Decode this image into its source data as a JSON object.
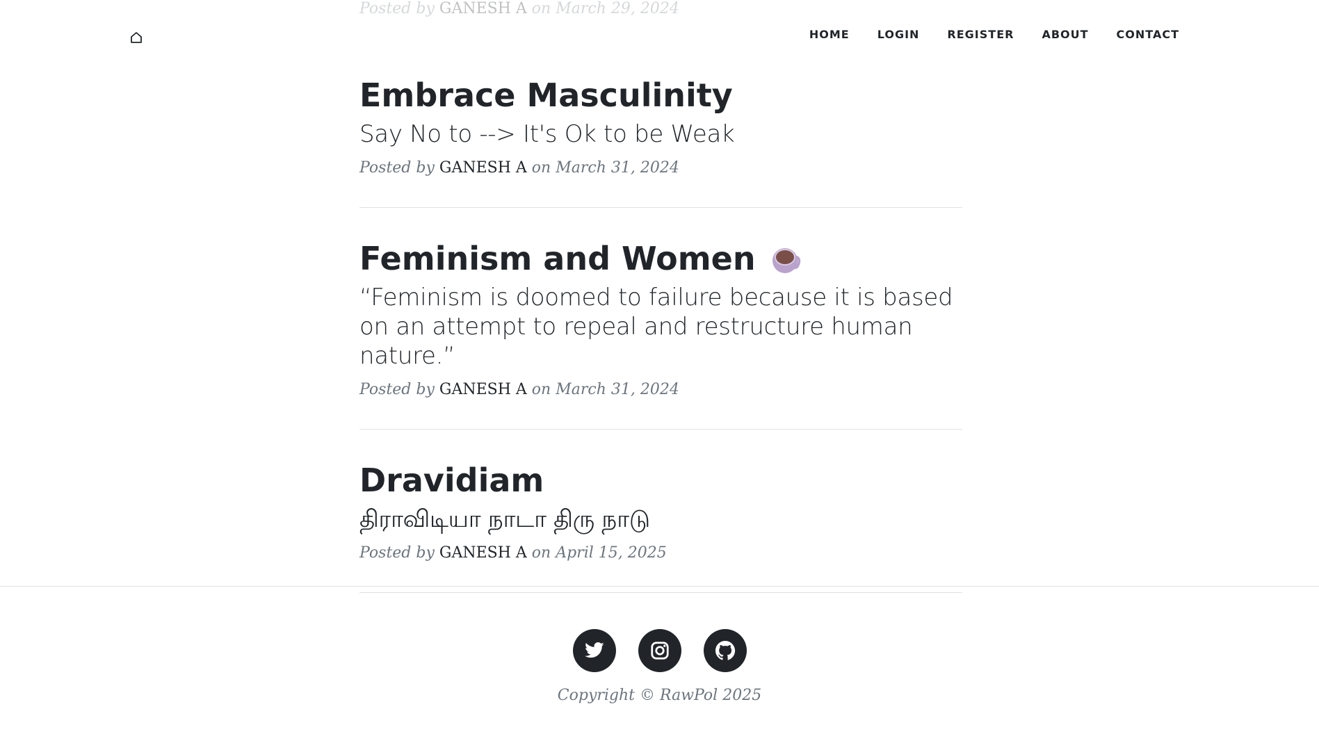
{
  "faded_meta": {
    "prefix": "Posted by ",
    "author": "GANESH A",
    "suffix": " on March 29, 2024"
  },
  "nav": {
    "brand_icon": "home-icon",
    "links": [
      "HOME",
      "LOGIN",
      "REGISTER",
      "ABOUT",
      "CONTACT"
    ]
  },
  "posts": [
    {
      "title": "Embrace Masculinity",
      "subtitle": "Say No to --> It's Ok to be Weak",
      "meta_prefix": "Posted by ",
      "author": "GANESH A",
      "date_text": " on March 31, 2024"
    },
    {
      "title": "Feminism and Women",
      "title_icon": "coffee-cup-icon",
      "subtitle": "“Feminism is doomed to failure because it is based on an attempt to repeal and restructure human nature.”",
      "meta_prefix": "Posted by ",
      "author": "GANESH A",
      "date_text": " on March 31, 2024"
    },
    {
      "title": "Dravidiam",
      "subtitle": "திராவிடியா நாடா திரு நாடு",
      "meta_prefix": "Posted by ",
      "author": "GANESH A",
      "date_text": " on April 15, 2025"
    }
  ],
  "footer": {
    "social": [
      "twitter-icon",
      "instagram-icon",
      "github-icon"
    ],
    "copyright": "Copyright © RawPol 2025"
  },
  "colors": {
    "text": "#212529",
    "muted": "#6c757d",
    "divider": "#dee2e6",
    "background": "#ffffff"
  }
}
